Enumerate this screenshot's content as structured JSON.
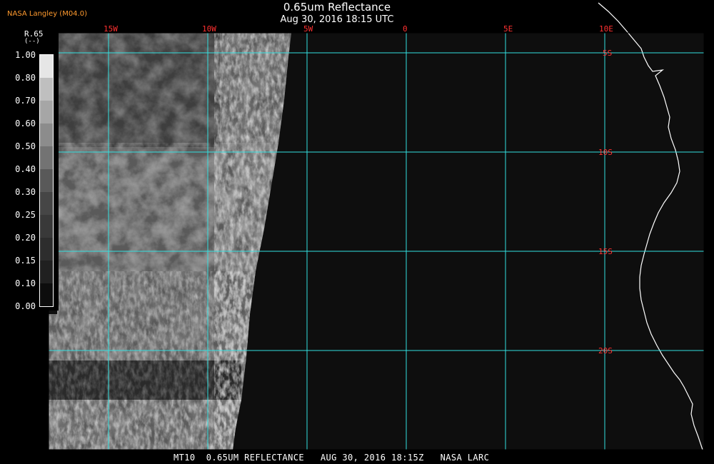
{
  "header": {
    "source": "NASA Langley (M04.0)",
    "title": "0.65um Reflectance",
    "subtitle": "Aug 30, 2016 18:15 UTC"
  },
  "footer": {
    "caption": "MT10  0.65UM REFLECTANCE   AUG 30, 2016 18:15Z   NASA LARC"
  },
  "legend": {
    "variable": "R.65",
    "unit": "(--)",
    "labels": [
      "1.00",
      "0.80",
      "0.70",
      "0.60",
      "0.50",
      "0.40",
      "0.30",
      "0.25",
      "0.20",
      "0.15",
      "0.10",
      "0.00"
    ],
    "values": [
      1.0,
      0.8,
      0.7,
      0.6,
      0.5,
      0.4,
      0.3,
      0.25,
      0.2,
      0.15,
      0.1,
      0.0
    ]
  },
  "map": {
    "longitude_labels": [
      "15W",
      "10W",
      "5W",
      "0",
      "5E",
      "10E"
    ],
    "latitude_labels": [
      "5S",
      "10S",
      "15S",
      "20S"
    ],
    "grid_color": "#33e0e0",
    "label_color": "#ff3030",
    "coastline_color": "#ffffff"
  }
}
